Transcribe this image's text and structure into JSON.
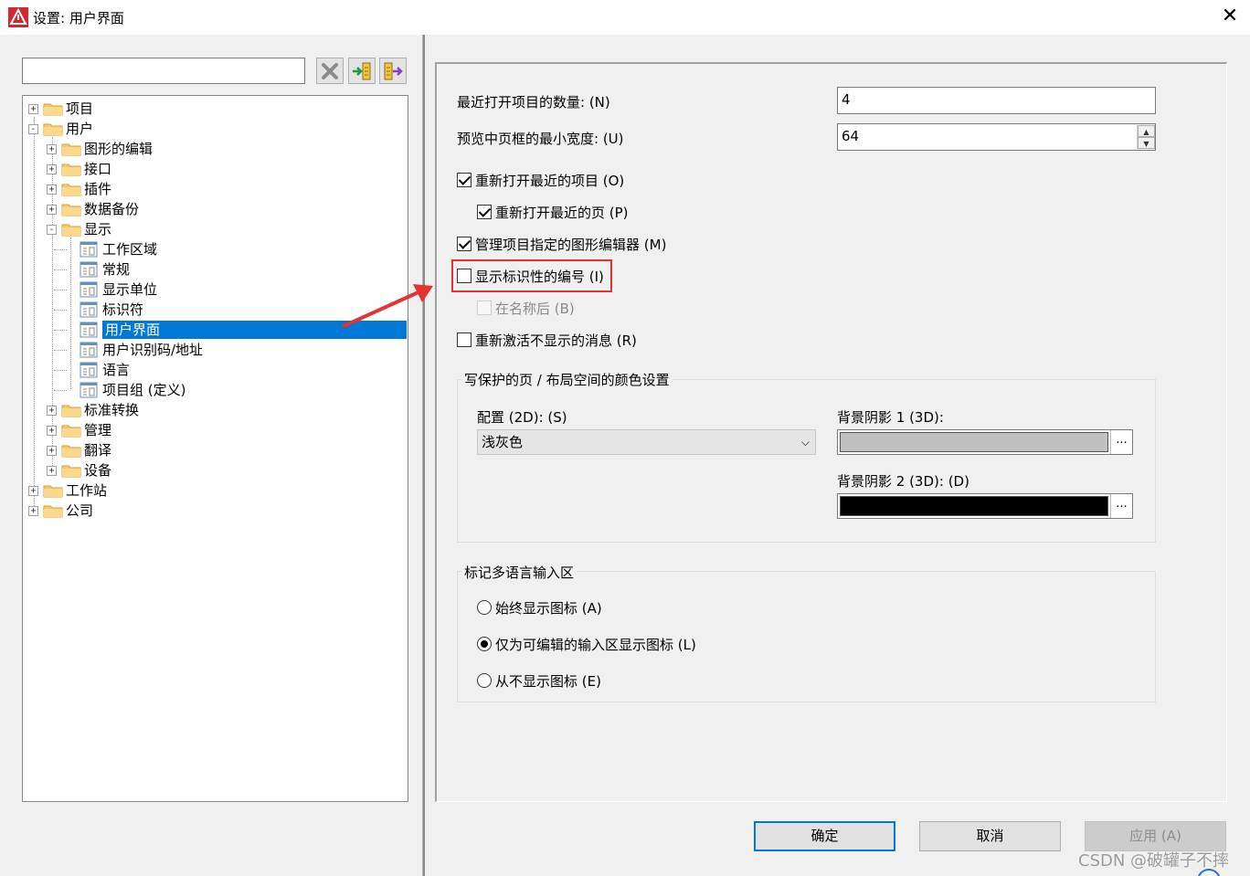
{
  "window": {
    "title": "设置: 用户界面",
    "close_glyph": "✕"
  },
  "left": {
    "search": {
      "value": "",
      "placeholder": ""
    },
    "toolbar": {
      "icons": [
        "delete-icon",
        "import-icon",
        "export-icon"
      ]
    },
    "tree": [
      {
        "label": "项目",
        "expander": "+",
        "icon": "folder-icon"
      },
      {
        "label": "用户",
        "expander": "-",
        "icon": "folder-icon"
      },
      {
        "label": "图形的编辑",
        "expander": "+",
        "icon": "folder-icon"
      },
      {
        "label": "接口",
        "expander": "+",
        "icon": "folder-icon"
      },
      {
        "label": "插件",
        "expander": "+",
        "icon": "folder-icon"
      },
      {
        "label": "数据备份",
        "expander": "+",
        "icon": "folder-icon"
      },
      {
        "label": "显示",
        "expander": "-",
        "icon": "folder-icon"
      },
      {
        "label": "工作区域",
        "icon": "settings-page-icon"
      },
      {
        "label": "常规",
        "icon": "settings-page-icon"
      },
      {
        "label": "显示单位",
        "icon": "settings-page-icon"
      },
      {
        "label": "标识符",
        "icon": "settings-page-icon"
      },
      {
        "label": "用户界面",
        "icon": "settings-page-icon",
        "selected": true
      },
      {
        "label": "用户识别码/地址",
        "icon": "settings-page-icon"
      },
      {
        "label": "语言",
        "icon": "settings-page-icon"
      },
      {
        "label": "项目组 (定义)",
        "icon": "settings-page-icon"
      },
      {
        "label": "标准转换",
        "expander": "+",
        "icon": "folder-icon"
      },
      {
        "label": "管理",
        "expander": "+",
        "icon": "folder-icon"
      },
      {
        "label": "翻译",
        "expander": "+",
        "icon": "folder-icon"
      },
      {
        "label": "设备",
        "expander": "+",
        "icon": "folder-icon"
      },
      {
        "label": "工作站",
        "expander": "+",
        "icon": "folder-icon"
      },
      {
        "label": "公司",
        "expander": "+",
        "icon": "folder-icon"
      }
    ]
  },
  "settings": {
    "recent_count_label": "最近打开项目的数量: (N)",
    "recent_count_value": "4",
    "preview_width_label": "预览中页框的最小宽度: (U)",
    "preview_width_value": "64",
    "reopen_projects": {
      "label": "重新打开最近的项目 (O)",
      "checked": true
    },
    "reopen_pages": {
      "label": "重新打开最近的页 (P)",
      "checked": true
    },
    "manage_editor": {
      "label": "管理项目指定的图形编辑器 (M)",
      "checked": true
    },
    "show_id_number": {
      "label": "显示标识性的编号 (I)",
      "checked": false
    },
    "after_name": {
      "label": "在名称后 (B)",
      "checked": false,
      "disabled": true
    },
    "reactivate_messages": {
      "label": "重新激活不显示的消息 (R)",
      "checked": false
    },
    "color_group": {
      "title": "写保护的页 / 布局空间的颜色设置",
      "config_label": "配置 (2D): (S)",
      "config_value": "浅灰色",
      "bg1_label": "背景阴影 1 (3D):",
      "bg1_color": "#c0c0c0",
      "bg2_label": "背景阴影 2 (3D): (D)",
      "bg2_color": "#000000",
      "ellipsis": "..."
    },
    "lang_group": {
      "title": "标记多语言输入区",
      "options": [
        {
          "label": "始终显示图标 (A)",
          "selected": false
        },
        {
          "label": "仅为可编辑的输入区显示图标 (L)",
          "selected": true
        },
        {
          "label": "从不显示图标 (E)",
          "selected": false
        }
      ]
    }
  },
  "buttons": {
    "ok": "确定",
    "cancel": "取消",
    "apply": "应用 (A)"
  },
  "watermark": "CSDN @破罐子不摔",
  "colors": {
    "accent": "#0078d7",
    "annotation": "#e53333"
  }
}
